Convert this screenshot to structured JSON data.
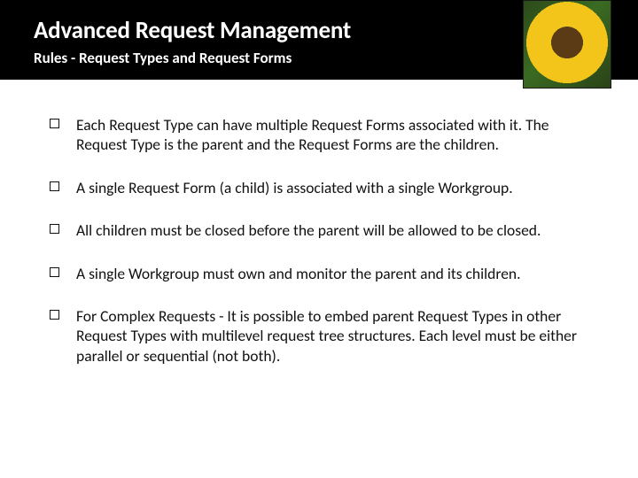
{
  "header": {
    "title": "Advanced Request Management",
    "subtitle": "Rules - Request Types and Request Forms"
  },
  "bullets": [
    "Each Request Type can have multiple Request Forms associated with it. The Request Type is the parent and the Request Forms are the children.",
    "A single Request Form (a child) is associated with a single Workgroup.",
    "All children must be closed before the parent will be allowed to be closed.",
    "A single Workgroup must own and monitor the parent and its children.",
    "For Complex Requests - It is possible to embed parent Request Types in other Request Types with multilevel request tree structures.  Each level must be either parallel or sequential (not both)."
  ]
}
